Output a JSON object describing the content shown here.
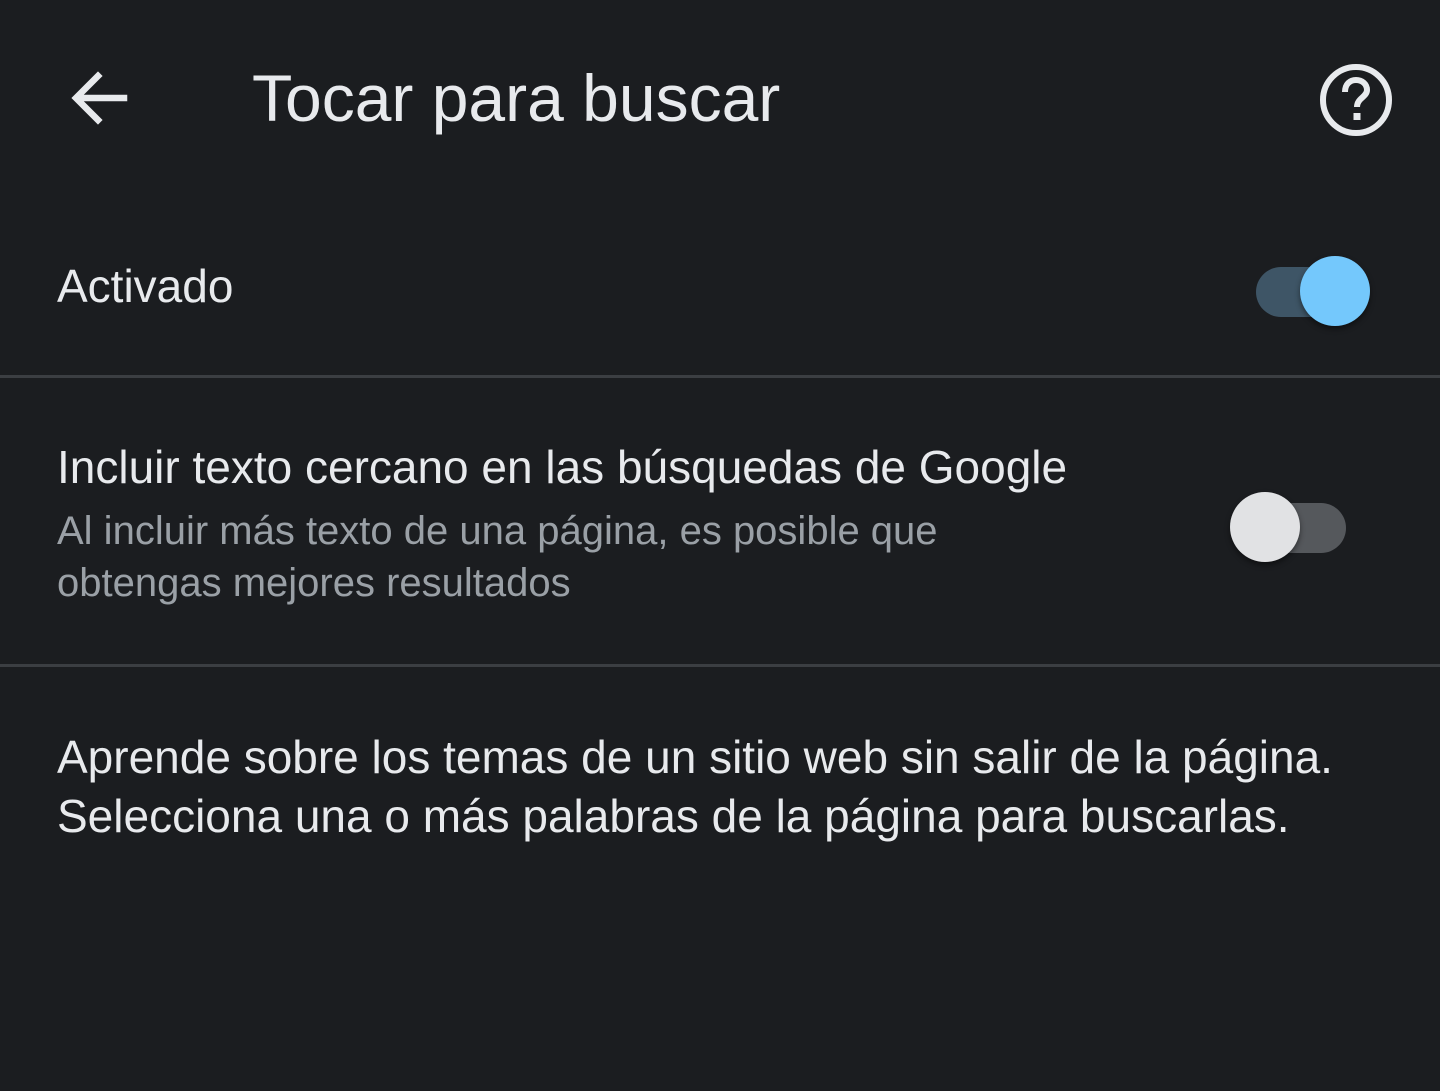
{
  "toolbar": {
    "back_icon": "arrow-left-icon",
    "title": "Tocar para buscar",
    "help_icon": "help-circle-icon"
  },
  "settings": {
    "enabled": {
      "label": "Activado",
      "checked": true
    },
    "nearby_text": {
      "label": "Incluir texto cercano en las búsquedas de Google",
      "summary": "Al incluir más texto de una página, es posible que obtengas mejores resultados",
      "checked": false
    }
  },
  "footer": {
    "description": "Aprende sobre los temas de un sitio web sin salir de la página. Selecciona una o más palabras de la página para buscarlas."
  },
  "colors": {
    "background": "#1b1d20",
    "primary_text": "#e8eaed",
    "secondary_text": "#9aa0a6",
    "switch_on_thumb": "#74c8fc",
    "switch_on_track": "#3e5566",
    "switch_off_thumb": "#e1e2e4",
    "switch_off_track": "#55585c",
    "divider": "#3b3e42"
  }
}
